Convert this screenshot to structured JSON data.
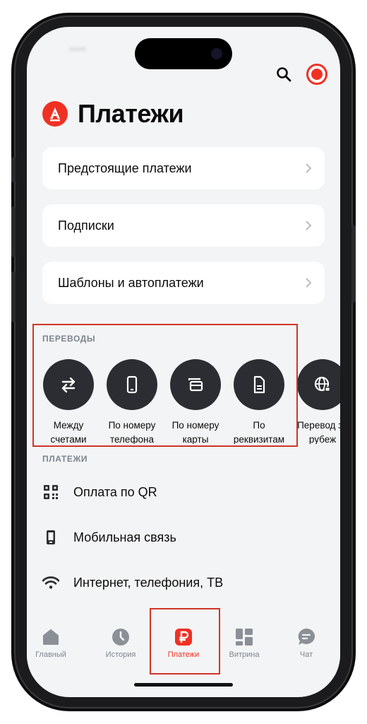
{
  "header": {
    "title": "Платежи",
    "logo_letter": "А",
    "search_icon": "search-icon",
    "avatar_icon": "profile-avatar"
  },
  "cards": [
    {
      "label": "Предстоящие платежи"
    },
    {
      "label": "Подписки"
    },
    {
      "label": "Шаблоны и автоплатежи"
    }
  ],
  "transfers": {
    "section_label": "ПЕРЕВОДЫ",
    "items": [
      {
        "label": "Между счетами",
        "icon": "arrows-swap-icon"
      },
      {
        "label": "По номеру телефона",
        "icon": "phone-icon"
      },
      {
        "label": "По номеру карты",
        "icon": "card-icon"
      },
      {
        "label": "По реквизитам",
        "icon": "document-icon"
      },
      {
        "label": "Перевод за рубеж",
        "icon": "globe-icon"
      }
    ]
  },
  "payments": {
    "section_label": "ПЛАТЕЖИ",
    "items": [
      {
        "label": "Оплата по QR",
        "icon": "qr-icon"
      },
      {
        "label": "Мобильная связь",
        "icon": "mobile-icon"
      },
      {
        "label": "Интернет, телефония, ТВ",
        "icon": "wifi-icon"
      }
    ]
  },
  "bottom_nav": {
    "items": [
      {
        "label": "Главный",
        "icon": "home-icon"
      },
      {
        "label": "История",
        "icon": "clock-icon"
      },
      {
        "label": "Платежи",
        "icon": "ruble-icon",
        "active": true
      },
      {
        "label": "Витрина",
        "icon": "grid-icon"
      },
      {
        "label": "Чат",
        "icon": "chat-icon"
      }
    ]
  },
  "colors": {
    "accent": "#ef3124",
    "dark_circle": "#2b2d33",
    "background": "#f3f4f5",
    "highlight_outline": "#d13427"
  }
}
